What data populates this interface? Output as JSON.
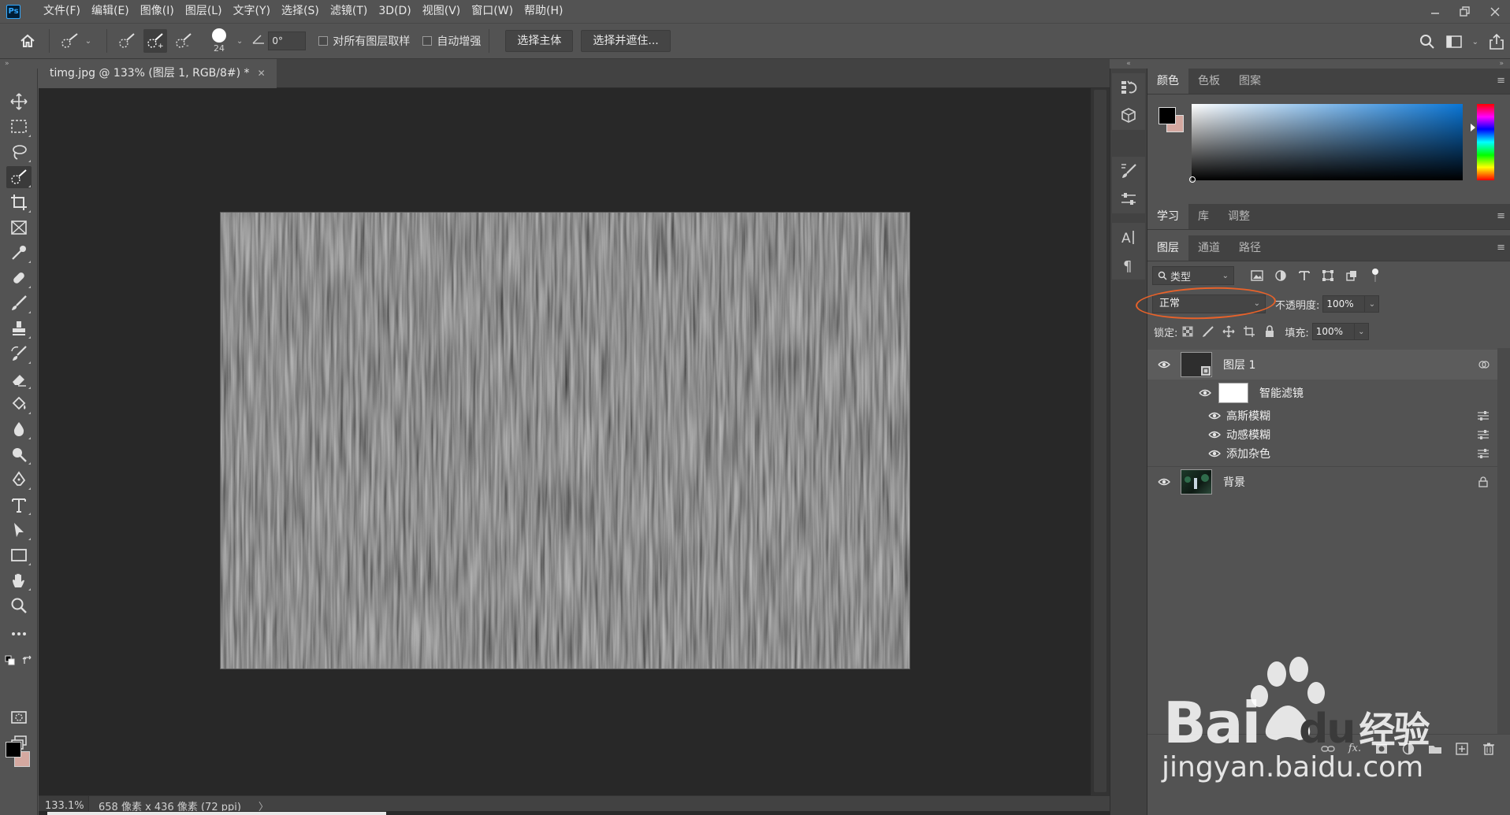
{
  "app": {
    "logo": "Ps"
  },
  "menu": [
    "文件(F)",
    "编辑(E)",
    "图像(I)",
    "图层(L)",
    "文字(Y)",
    "选择(S)",
    "滤镜(T)",
    "3D(D)",
    "视图(V)",
    "窗口(W)",
    "帮助(H)"
  ],
  "options": {
    "brush_size": "24",
    "angle": "0°",
    "sample_all_layers": "对所有图层取样",
    "auto_enhance": "自动增强",
    "select_subject": "选择主体",
    "select_and_mask": "选择并遮住..."
  },
  "document": {
    "tab_title": "timg.jpg @ 133% (图层 1, RGB/8#) *",
    "zoom": "133.1%",
    "info": "658 像素 x 436 像素 (72 ppi)"
  },
  "colors": {
    "foreground": "#000000",
    "background": "#d4a8a0",
    "annotation": "#e8622a"
  },
  "color_panel": {
    "tabs": [
      "颜色",
      "色板",
      "图案"
    ]
  },
  "learn_panel": {
    "tabs": [
      "学习",
      "库",
      "调整"
    ]
  },
  "layers_panel": {
    "tabs": [
      "图层",
      "通道",
      "路径"
    ],
    "kind_filter": "类型",
    "blend_mode": "正常",
    "opacity_label": "不透明度:",
    "opacity": "100%",
    "lock_label": "锁定:",
    "fill_label": "填充:",
    "fill": "100%",
    "layers": [
      {
        "name": "图层 1"
      },
      {
        "name": "智能滤镜"
      },
      {
        "name": "高斯模糊"
      },
      {
        "name": "动感模糊"
      },
      {
        "name": "添加杂色"
      },
      {
        "name": "背景"
      }
    ]
  },
  "watermark": {
    "brand": "Bai",
    "brand2": "du",
    "brand_cn": "经验",
    "url": "jingyan.baidu.com"
  }
}
